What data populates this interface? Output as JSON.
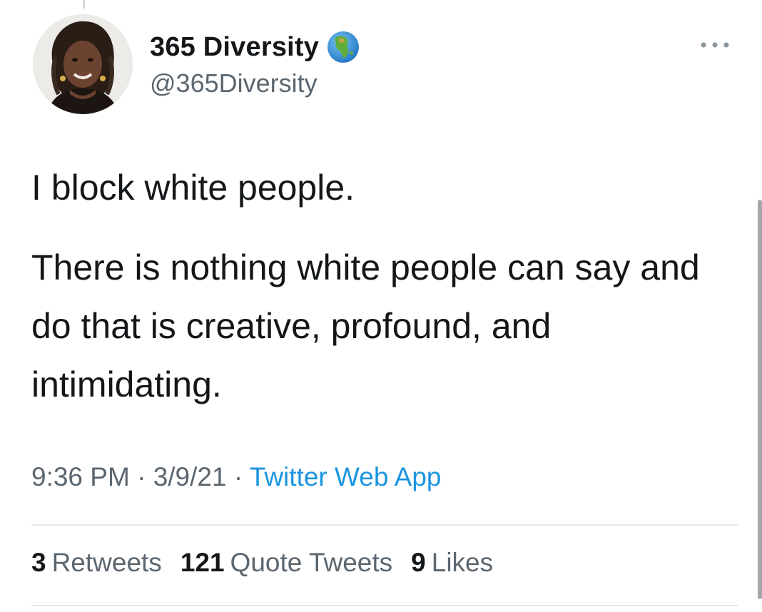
{
  "user": {
    "display_name": "365 Diversity",
    "handle": "@365Diversity",
    "avatar_icon": "profile-photo",
    "badge_icon": "globe-africa-icon"
  },
  "tweet": {
    "paragraphs": [
      "I block white people.",
      "There is nothing white people can say and do that is creative, profound, and intimidating."
    ],
    "time": "9:36 PM",
    "date": "3/9/21",
    "source": "Twitter Web App",
    "separator": " · "
  },
  "stats": {
    "retweets_count": "3",
    "retweets_label": "Retweets",
    "quotes_count": "121",
    "quotes_label": "Quote Tweets",
    "likes_count": "9",
    "likes_label": "Likes"
  },
  "colors": {
    "text": "#14171a",
    "secondary": "#5b6670",
    "link": "#1b95e0",
    "divider": "#e6e9eb"
  }
}
